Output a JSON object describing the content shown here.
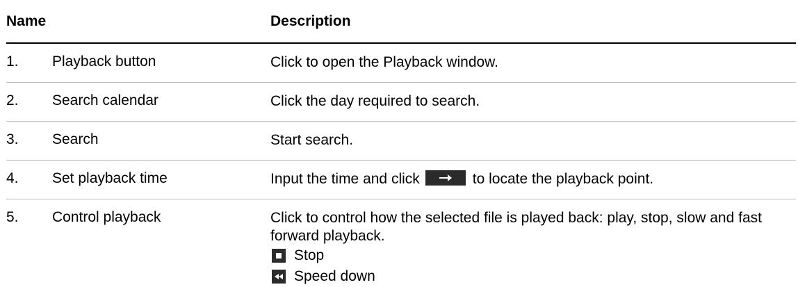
{
  "table": {
    "header": {
      "name": "Name",
      "description": "Description"
    },
    "rows": [
      {
        "number": "1.",
        "name": "Playback button",
        "description": "Click to open the Playback window."
      },
      {
        "number": "2.",
        "name": "Search calendar",
        "description": "Click the day required to search."
      },
      {
        "number": "3.",
        "name": "Search",
        "description": "Start search."
      },
      {
        "number": "4.",
        "name": "Set playback time",
        "description_before": "Input the time and click",
        "description_after": "to locate the playback point.",
        "icon": "right-arrow-icon"
      },
      {
        "number": "5.",
        "name": "Control playback",
        "description": "Click to control how the selected file is played back:  play, stop, slow and fast forward playback.",
        "sub_items": [
          {
            "icon": "stop-icon",
            "label": "Stop"
          },
          {
            "icon": "rewind-icon",
            "label": "Speed down"
          }
        ]
      }
    ]
  },
  "colors": {
    "icon_background": "#2b2b2b",
    "divider": "#b8b8b8",
    "header_rule": "#000000"
  }
}
